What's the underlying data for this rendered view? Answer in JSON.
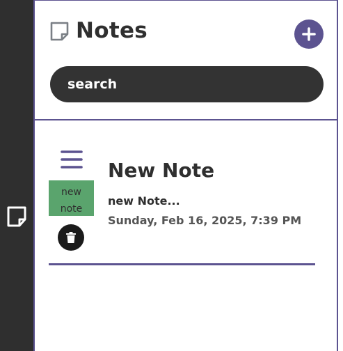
{
  "app": {
    "title": "Notes",
    "title_icon": "sticky-note-icon",
    "accent_color": "#5c5390"
  },
  "rail": {
    "icon": "sticky-note-icon"
  },
  "header": {
    "add_icon": "plus-icon"
  },
  "search": {
    "placeholder": "search",
    "value": ""
  },
  "notes": [
    {
      "title": "New Note",
      "preview": "new Note...",
      "date": "Sunday, Feb 16, 2025, 7:39 PM",
      "tag": "new note",
      "tag_color": "#5aa46d",
      "handle_icon": "drag-handle-icon",
      "delete_icon": "trash-icon"
    }
  ]
}
